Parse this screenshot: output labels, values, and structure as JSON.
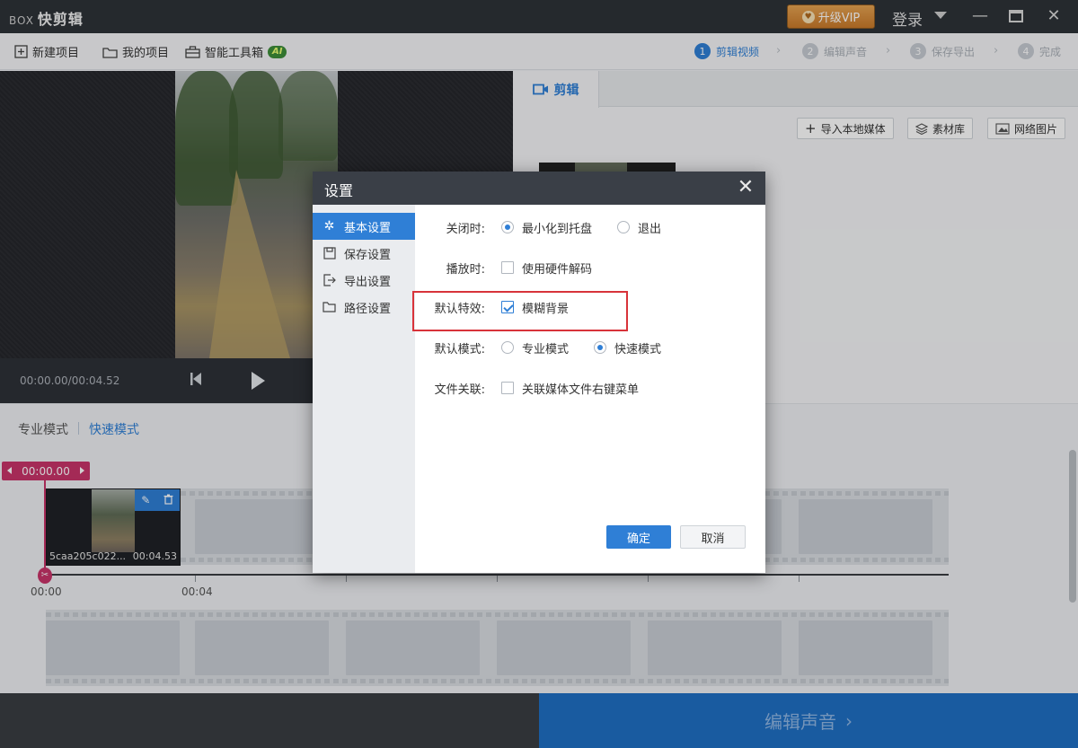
{
  "app": {
    "logo_prefix": "BOX",
    "title": "快剪辑",
    "vip_button": "升级VIP",
    "login": "登录"
  },
  "toolbar": {
    "new_project": "新建项目",
    "my_projects": "我的项目",
    "smart_toolbox": "智能工具箱",
    "ai_badge": "AI"
  },
  "steps": [
    {
      "num": "1",
      "label": "剪辑视频"
    },
    {
      "num": "2",
      "label": "编辑声音"
    },
    {
      "num": "3",
      "label": "保存导出"
    },
    {
      "num": "4",
      "label": "完成"
    }
  ],
  "player": {
    "timecode": "00:00.00/00:04.52"
  },
  "right_panel": {
    "tab": "剪辑",
    "import_local": "导入本地媒体",
    "material_lib": "素材库",
    "web_images": "网络图片"
  },
  "modes": {
    "pro": "专业模式",
    "fast": "快速模式"
  },
  "timeline": {
    "playhead": "00:00.00",
    "clip_name": "5caa205c022...",
    "clip_duration": "00:04.53",
    "tick_0": "00:00",
    "tick_1": "00:04"
  },
  "bottom": {
    "next": "编辑声音"
  },
  "dialog": {
    "title": "设置",
    "sidebar": [
      "基本设置",
      "保存设置",
      "导出设置",
      "路径设置"
    ],
    "close_label": "关闭时:",
    "close_opt_tray": "最小化到托盘",
    "close_opt_exit": "退出",
    "play_label": "播放时:",
    "play_opt_hw": "使用硬件解码",
    "effect_label": "默认特效:",
    "effect_opt_blur": "模糊背景",
    "mode_label": "默认模式:",
    "mode_opt_pro": "专业模式",
    "mode_opt_fast": "快速模式",
    "assoc_label": "文件关联:",
    "assoc_opt_menu": "关联媒体文件右键菜单",
    "ok": "确定",
    "cancel": "取消"
  },
  "colors": {
    "accent": "#2f7fd6",
    "playhead": "#c8346a",
    "highlight": "#d8333a"
  }
}
